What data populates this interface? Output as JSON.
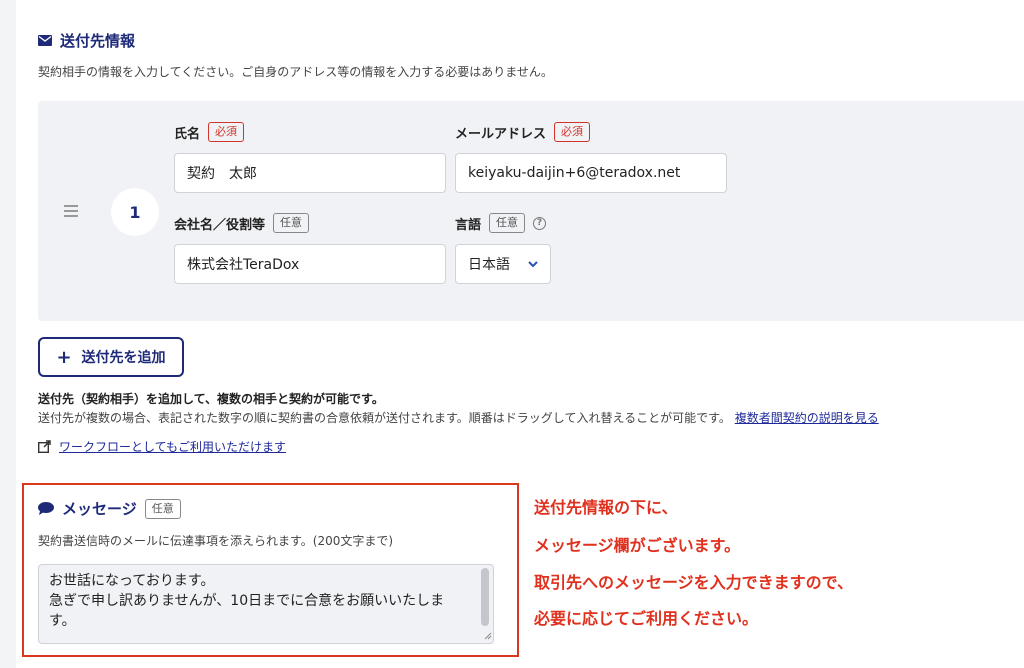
{
  "recipient_section": {
    "title": "送付先情報",
    "description": "契約相手の情報を入力してください。ご自身のアドレス等の情報を入力する必要はありません。",
    "recipients": [
      {
        "order": "1",
        "name_label": "氏名",
        "name_value": "契約　太郎",
        "email_label": "メールアドレス",
        "email_value": "keiyaku-daijin+6@teradox.net",
        "company_label": "会社名／役割等",
        "company_value": "株式会社TeraDox",
        "language_label": "言語",
        "language_value": "日本語"
      }
    ],
    "required_badge": "必須",
    "optional_badge": "任意",
    "help_glyph": "?"
  },
  "add_button": {
    "plus": "+",
    "label": "送付先を追加"
  },
  "info": {
    "bold": "送付先（契約相手）を追加して、複数の相手と契約が可能です。",
    "text": "送付先が複数の場合、表記された数字の順に契約書の合意依頼が送付されます。順番はドラッグして入れ替えることが可能です。",
    "link": "複数者間契約の説明を見る",
    "workflow_link": "ワークフローとしてもご利用いただけます"
  },
  "message_section": {
    "title": "メッセージ",
    "badge": "任意",
    "description": "契約書送信時のメールに伝達事項を添えられます。(200文字まで)",
    "value": "お世話になっております。\n急ぎで申し訳ありませんが、10日までに合意をお願いいたします。"
  },
  "annotation": {
    "lines": [
      "送付先情報の下に、",
      "メッセージ欄がございます。",
      "取引先へのメッセージを入力できますので、",
      "必要に応じてご利用ください。"
    ]
  },
  "colors": {
    "brand": "#1e2a78",
    "required": "#d0342c",
    "annotation": "#e0301e"
  }
}
